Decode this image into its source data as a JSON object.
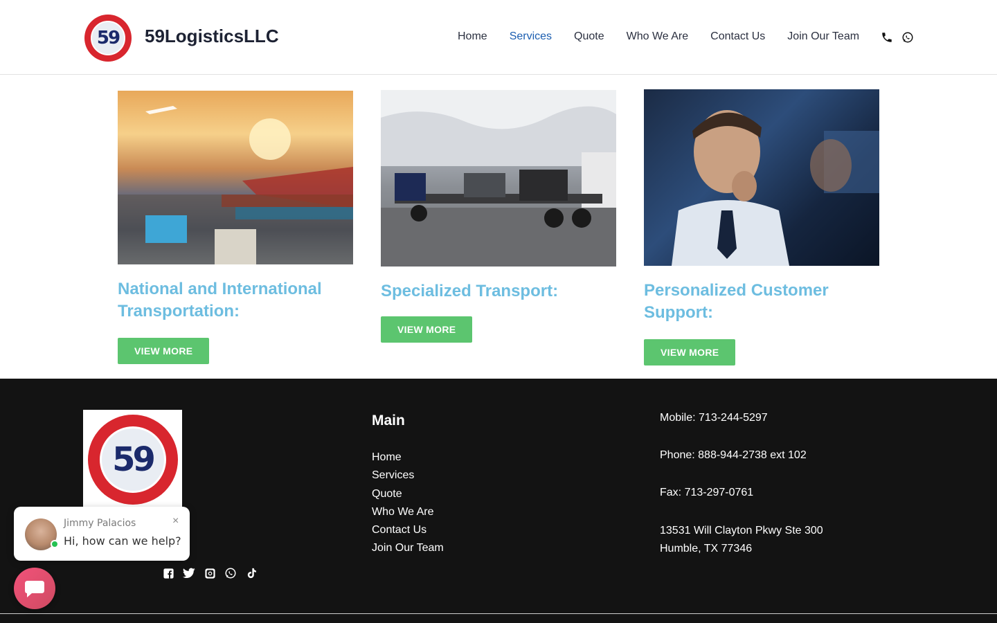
{
  "header": {
    "brand": "59LogisticsLLC",
    "logo_text": "59",
    "nav": [
      {
        "label": "Home",
        "active": false
      },
      {
        "label": "Services",
        "active": true
      },
      {
        "label": "Quote",
        "active": false
      },
      {
        "label": "Who We Are",
        "active": false
      },
      {
        "label": "Contact Us",
        "active": false
      },
      {
        "label": "Join Our Team",
        "active": false
      }
    ],
    "icons": [
      "phone-icon",
      "whatsapp-icon"
    ]
  },
  "services": [
    {
      "title": "National and International Transportation:",
      "button": "VIEW MORE",
      "image": "port-logistics-photo"
    },
    {
      "title": "Specialized Transport:",
      "button": "VIEW MORE",
      "image": "flatbed-truck-photo"
    },
    {
      "title": "Personalized Customer Support:",
      "button": "VIEW MORE",
      "image": "customer-support-agent-photo"
    }
  ],
  "footer": {
    "logo_text": "59",
    "main_title": "Main",
    "links": [
      "Home",
      "Services",
      "Quote",
      "Who We Are",
      "Contact Us",
      "Join Our Team"
    ],
    "contact": {
      "mobile": "Mobile: 713-244-5297",
      "phone": "Phone: 888-944-2738 ext 102",
      "fax": "Fax: 713-297-0761",
      "address_line1": "13531 Will Clayton Pkwy Ste 300",
      "address_line2": "Humble, TX 77346"
    },
    "social_icons": [
      "facebook-icon",
      "twitter-icon",
      "instagram-icon",
      "whatsapp-icon",
      "tiktok-icon"
    ]
  },
  "chat": {
    "name": "Jimmy Palacios",
    "message": "Hi, how can we help?",
    "close": "×"
  },
  "colors": {
    "accent_blue": "#1a5db0",
    "heading_blue": "#6dbde0",
    "button_green": "#5cc56f",
    "footer_bg": "#131313",
    "chat_pink": "#f2527a"
  }
}
